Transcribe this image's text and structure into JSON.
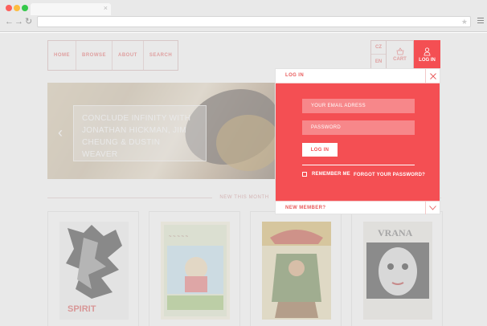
{
  "browser": {
    "back_icon": "arrow-left-icon",
    "forward_icon": "arrow-right-icon",
    "reload_icon": "reload-icon",
    "bookmark_icon": "star-icon",
    "menu_icon": "hamburger-icon"
  },
  "nav": {
    "items": [
      {
        "label": "HOME"
      },
      {
        "label": "BROWSE"
      },
      {
        "label": "ABOUT"
      },
      {
        "label": "SEARCH"
      }
    ]
  },
  "lang": {
    "options": [
      "CZ",
      "EN"
    ]
  },
  "cart": {
    "label": "CART",
    "icon": "basket-icon"
  },
  "login_tab": {
    "label": "LOG IN",
    "icon": "user-icon"
  },
  "hero": {
    "caption": [
      "CONCLUDE INFINITY WITH",
      "JONATHAN HICKMAN, JIM",
      "CHEUNG & DUSTIN WEAVER"
    ]
  },
  "section": {
    "new_this_month": "NEW THIS MONTH"
  },
  "login_panel": {
    "title": "LOG IN",
    "email_placeholder": "YOUR EMAIL ADRESS",
    "password_placeholder": "PASSWORD",
    "submit_label": "LOG IN",
    "remember_label": "REMEMBER ME",
    "forgot_label": "FORGOT YOUR PASSWORD?",
    "new_member_label": "NEW MEMBER?"
  },
  "colors": {
    "accent": "#f44f53",
    "accent_light": "#f7878a",
    "nav_text": "#e85a5a"
  }
}
